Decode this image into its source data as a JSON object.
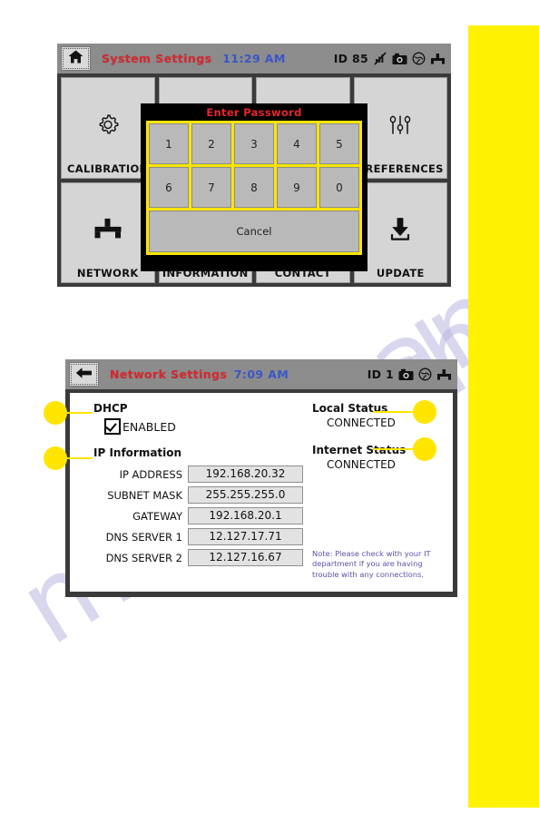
{
  "page": {
    "watermark": "manualshive.com"
  },
  "screen1": {
    "titlebar": {
      "home_icon": "home-icon",
      "title": "System Settings",
      "time": "11:29 AM",
      "id": "ID 85",
      "icons": [
        "signal-off-icon",
        "camera-icon",
        "globe-icon",
        "network-icon"
      ]
    },
    "tiles": [
      {
        "label": "CALIBRATION",
        "icon": "gear-icon"
      },
      {
        "label": "",
        "icon": ""
      },
      {
        "label": "",
        "icon": ""
      },
      {
        "label": "PREFERENCES",
        "icon": "sliders-icon"
      },
      {
        "label": "NETWORK",
        "icon": "network-icon"
      },
      {
        "label": "INFORMATION",
        "icon": "info-post-icon"
      },
      {
        "label": "CONTACT",
        "icon": "contact-card-icon"
      },
      {
        "label": "UPDATE",
        "icon": "download-icon"
      }
    ],
    "password_dialog": {
      "title": "Enter Password",
      "keys": [
        "1",
        "2",
        "3",
        "4",
        "5",
        "6",
        "7",
        "8",
        "9",
        "0"
      ],
      "cancel_label": "Cancel"
    }
  },
  "screen2": {
    "titlebar": {
      "back_icon": "back-arrow-icon",
      "title": "Network Settings",
      "time": "7:09 AM",
      "id": "ID 1",
      "icons": [
        "camera-icon",
        "globe-icon",
        "network-icon"
      ]
    },
    "dhcp": {
      "heading": "DHCP",
      "checkbox_label": "ENABLED",
      "checked": true
    },
    "ip_information": {
      "heading": "IP Information",
      "rows": [
        {
          "label": "IP ADDRESS",
          "value": "192.168.20.32"
        },
        {
          "label": "SUBNET MASK",
          "value": "255.255.255.0"
        },
        {
          "label": "GATEWAY",
          "value": "192.168.20.1"
        },
        {
          "label": "DNS SERVER 1",
          "value": "12.127.17.71"
        },
        {
          "label": "DNS SERVER 2",
          "value": "12.127.16.67"
        }
      ]
    },
    "statuses": [
      {
        "title": "Local Status",
        "value": "CONNECTED"
      },
      {
        "title": "Internet Status",
        "value": "CONNECTED"
      }
    ],
    "note": "Note: Please check with your IT department if you are having trouble with any connections."
  },
  "colors": {
    "accent_yellow": "#fff200",
    "title_red": "#d9272e",
    "time_blue": "#3a56c8",
    "note_purple": "#5b51a8"
  }
}
